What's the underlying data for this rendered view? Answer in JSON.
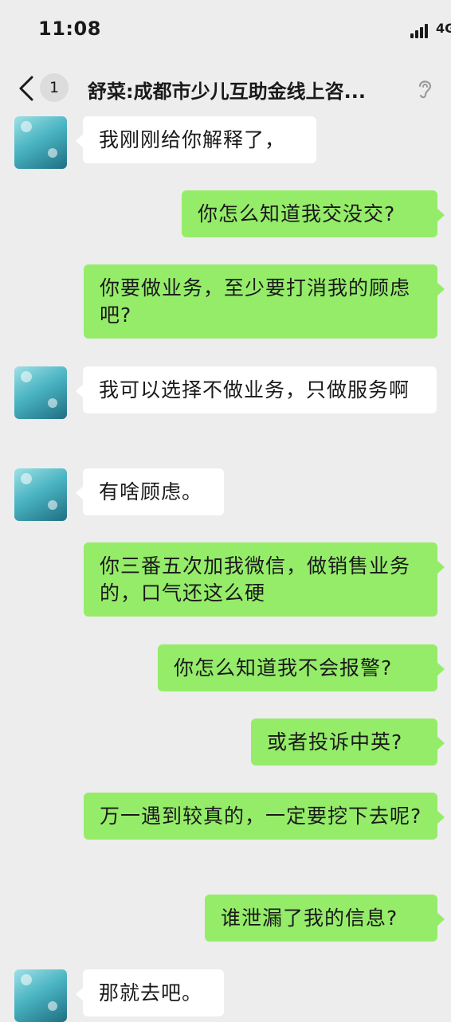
{
  "status_bar": {
    "time": "11:08",
    "network": "4G"
  },
  "header": {
    "back_badge": "1",
    "title": "舒菜:成都市少儿互助金线上咨..."
  },
  "messages": [
    {
      "side": "in",
      "text": "我刚刚给你解释了，"
    },
    {
      "side": "out",
      "text": "你怎么知道我交没交?"
    },
    {
      "side": "out",
      "text": "你要做业务，至少要打消我的顾虑吧?"
    },
    {
      "side": "in",
      "text": "我可以选择不做业务，只做服务啊"
    },
    {
      "side": "in",
      "text": "有啥顾虑。"
    },
    {
      "side": "out",
      "text": "你三番五次加我微信，做销售业务的，口气还这么硬"
    },
    {
      "side": "out",
      "text": "你怎么知道我不会报警?"
    },
    {
      "side": "out",
      "text": "或者投诉中英?"
    },
    {
      "side": "out",
      "text": "万一遇到较真的，一定要挖下去呢?"
    },
    {
      "side": "out",
      "text": "谁泄漏了我的信息?"
    },
    {
      "side": "in",
      "text": "那就去吧。"
    }
  ],
  "colors": {
    "outgoing_bubble": "#95ec69",
    "incoming_bubble": "#ffffff",
    "background": "#ededed"
  },
  "icons": {
    "back": "chevron-left-icon",
    "ear": "ear-icon",
    "signal": "signal-bars-icon"
  }
}
